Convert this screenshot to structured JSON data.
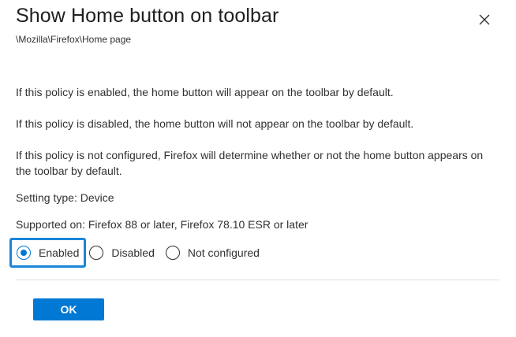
{
  "dialog": {
    "title": "Show Home button on toolbar",
    "breadcrumb": "\\Mozilla\\Firefox\\Home page",
    "close_icon": "close-icon"
  },
  "description": {
    "enabled_text": "If this policy is enabled, the home button will appear on the toolbar by default.",
    "disabled_text": "If this policy is disabled, the home button will not appear on the toolbar by default.",
    "not_configured_text": "If this policy is not configured, Firefox will determine whether or not the home button appears on the toolbar by default.",
    "setting_type": "Setting type: Device",
    "supported_on": "Supported on: Firefox 88 or later, Firefox 78.10 ESR or later"
  },
  "options": {
    "selected": "Enabled",
    "items": [
      {
        "label": "Enabled",
        "checked": true
      },
      {
        "label": "Disabled",
        "checked": false
      },
      {
        "label": "Not configured",
        "checked": false
      }
    ]
  },
  "footer": {
    "ok_label": "OK"
  },
  "colors": {
    "accent": "#0078d4",
    "focus_ring": "#1a86d9",
    "divider": "#e1dfdd"
  }
}
